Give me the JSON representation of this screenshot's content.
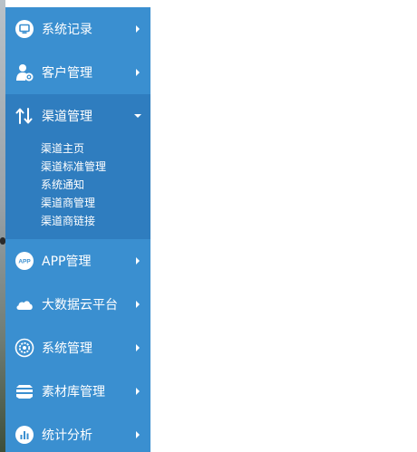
{
  "sidebar": {
    "items": [
      {
        "label": "系统记录",
        "icon": "monitor-icon"
      },
      {
        "label": "客户管理",
        "icon": "user-gear-icon"
      },
      {
        "label": "渠道管理",
        "icon": "transfer-arrows-icon",
        "expanded": true,
        "children": [
          {
            "label": "渠道主页"
          },
          {
            "label": "渠道标准管理"
          },
          {
            "label": "系统通知"
          },
          {
            "label": "渠道商管理"
          },
          {
            "label": "渠道商链接"
          }
        ]
      },
      {
        "label": "APP管理",
        "icon": "app-icon",
        "icon_text": "APP"
      },
      {
        "label": "大数据云平台",
        "icon": "cloud-icon"
      },
      {
        "label": "系统管理",
        "icon": "gear-icon"
      },
      {
        "label": "素材库管理",
        "icon": "layers-icon"
      },
      {
        "label": "统计分析",
        "icon": "bar-chart-icon"
      }
    ]
  },
  "colors": {
    "sidebar_bg": "#3a8fd0",
    "active_bg": "#2f7dbf",
    "text": "#ffffff"
  }
}
